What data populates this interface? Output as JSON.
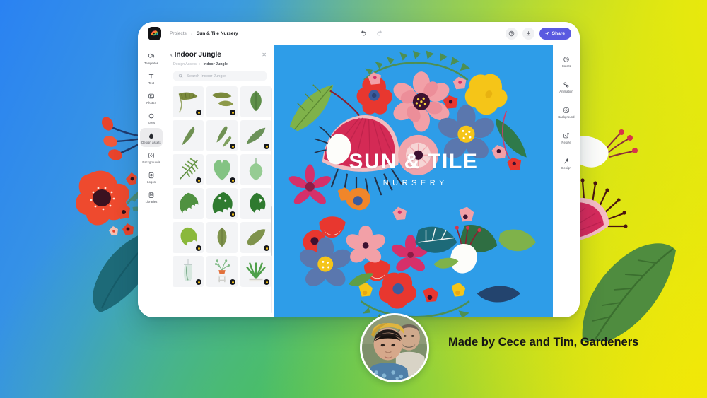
{
  "background": {
    "gradient_from": "#2a82f2",
    "gradient_mid": "#5bbd7e",
    "gradient_to": "#e9e70d",
    "decor": [
      "red-poppy-flower",
      "coral-berries",
      "teal-leaf",
      "magenta-fan-flower",
      "white-bud",
      "green-leaf"
    ]
  },
  "app": {
    "logo_icon": "adobe-express-logo-icon",
    "breadcrumb": {
      "root_label": "Projects",
      "separator": "›",
      "current_label": "Sun & Tile Nursery"
    },
    "history": {
      "undo_icon": "undo-arrow-icon",
      "redo_icon": "redo-arrow-icon",
      "undo_enabled": "active",
      "redo_enabled": "disabled"
    },
    "actions": {
      "help_icon": "help-circle-icon",
      "download_icon": "download-icon",
      "share_icon": "send-plane-icon",
      "share_label": "Share",
      "share_color": "#5a5ae0"
    }
  },
  "left_rail": {
    "items": [
      {
        "label": "Templates",
        "icon": "templates-icon",
        "active": false
      },
      {
        "label": "Text",
        "icon": "text-t-icon",
        "active": false
      },
      {
        "label": "Photos",
        "icon": "photos-image-icon",
        "active": false
      },
      {
        "label": "Icons",
        "icon": "circle-shape-icon",
        "active": false
      },
      {
        "label": "Design assets",
        "icon": "design-assets-icon",
        "active": true
      },
      {
        "label": "Backgrounds",
        "icon": "backgrounds-icon",
        "active": false
      },
      {
        "label": "Logos",
        "icon": "logos-badge-icon",
        "active": false
      },
      {
        "label": "Libraries",
        "icon": "libraries-icon",
        "active": false
      }
    ]
  },
  "panel": {
    "back_icon": "chevron-left-icon",
    "title": "Indoor Jungle",
    "close_icon": "close-x-icon",
    "breadcrumb": {
      "parent": "Design Assets",
      "separator": "›",
      "current": "Indoor Jungle"
    },
    "search": {
      "icon": "search-icon",
      "placeholder": "Search Indoor Jungle"
    },
    "assets": [
      {
        "name": "banana-leaf-olive",
        "badge": true
      },
      {
        "name": "banana-leaf-double",
        "badge": true
      },
      {
        "name": "oval-leaf-green",
        "badge": false
      },
      {
        "name": "slim-leaf-sage",
        "badge": false
      },
      {
        "name": "slim-leaf-pair",
        "badge": true
      },
      {
        "name": "wide-leaf-sage",
        "badge": true
      },
      {
        "name": "fern-frond",
        "badge": true
      },
      {
        "name": "heart-leaf-mint",
        "badge": true
      },
      {
        "name": "round-leaf-mint",
        "badge": false
      },
      {
        "name": "monstera-leaf",
        "badge": false
      },
      {
        "name": "monstera-leaf-dark",
        "badge": true
      },
      {
        "name": "monstera-split",
        "badge": false
      },
      {
        "name": "monstera-leaf-lime",
        "badge": true
      },
      {
        "name": "laurel-leaf-olive",
        "badge": false
      },
      {
        "name": "laurel-leaf-tilted",
        "badge": true
      },
      {
        "name": "hanging-planter",
        "badge": true
      },
      {
        "name": "potted-plant-stand",
        "badge": true
      },
      {
        "name": "aloe-plant",
        "badge": true
      }
    ]
  },
  "canvas": {
    "background_color": "#2e9de8",
    "design_title": "SUN & TILE",
    "design_subtitle": "NURSERY",
    "artwork": "floral-wreath-illustration"
  },
  "right_rail": {
    "items": [
      {
        "label": "Colors",
        "icon": "color-palette-icon"
      },
      {
        "label": "Animation",
        "icon": "animation-icon"
      },
      {
        "label": "Background",
        "icon": "background-grid-icon"
      },
      {
        "label": "Resize",
        "icon": "resize-icon"
      },
      {
        "label": "Design",
        "icon": "magic-wand-icon"
      }
    ]
  },
  "caption": {
    "avatar_icon": "couple-photo-avatar",
    "text": "Made by Cece and Tim, Gardeners"
  }
}
